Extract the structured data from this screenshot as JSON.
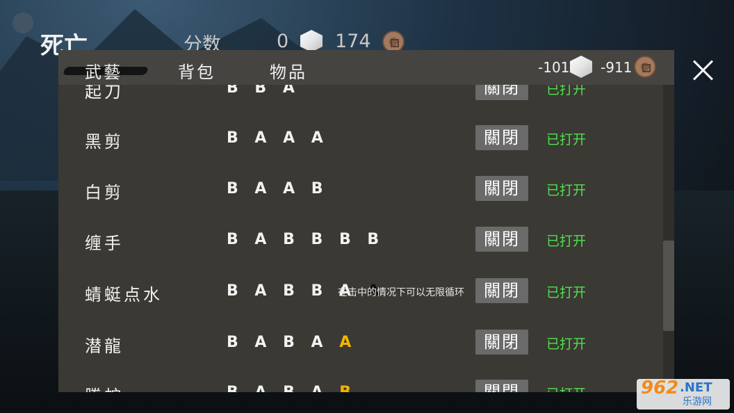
{
  "header": {
    "title": "死亡",
    "score_label": "分数",
    "score_value": "0",
    "cube_value": "174",
    "coin_icon": "copper-coin-icon",
    "cube_icon": "white-cube-icon"
  },
  "tabs": [
    {
      "label": "武藝"
    },
    {
      "label": "背包"
    },
    {
      "label": "物品"
    }
  ],
  "resources": {
    "cube_value": "-101",
    "coin_value": "-911"
  },
  "skills": [
    {
      "name": "起刀",
      "seq": "B B A",
      "highlight": "",
      "note": "",
      "button": "關閉",
      "status": "已打开"
    },
    {
      "name": "黑剪",
      "seq": "B A A A",
      "highlight": "",
      "note": "",
      "button": "關閉",
      "status": "已打开"
    },
    {
      "name": "白剪",
      "seq": "B A A B",
      "highlight": "",
      "note": "",
      "button": "關閉",
      "status": "已打开"
    },
    {
      "name": "缠手",
      "seq": "B A B B B B",
      "highlight": "",
      "note": "",
      "button": "關閉",
      "status": "已打开"
    },
    {
      "name": "蜻蜓点水",
      "seq": "B A B B A",
      "highlight": "A",
      "note": "在击中的情况下可以无限循环",
      "button": "關閉",
      "status": "已打开"
    },
    {
      "name": "潜龍",
      "seq": "B A B A",
      "highlight": "A",
      "note": "",
      "button": "關閉",
      "status": "已打开"
    },
    {
      "name": "騰蛇",
      "seq": "B A B A",
      "highlight": "B",
      "note": "",
      "button": "關閉",
      "status": "已打开"
    }
  ],
  "watermark": {
    "big": "962",
    "net": ".NET",
    "small": "乐游网"
  },
  "colors": {
    "status": "#4fe14f",
    "highlight": "#f4b400",
    "panel": "#3b3934"
  }
}
